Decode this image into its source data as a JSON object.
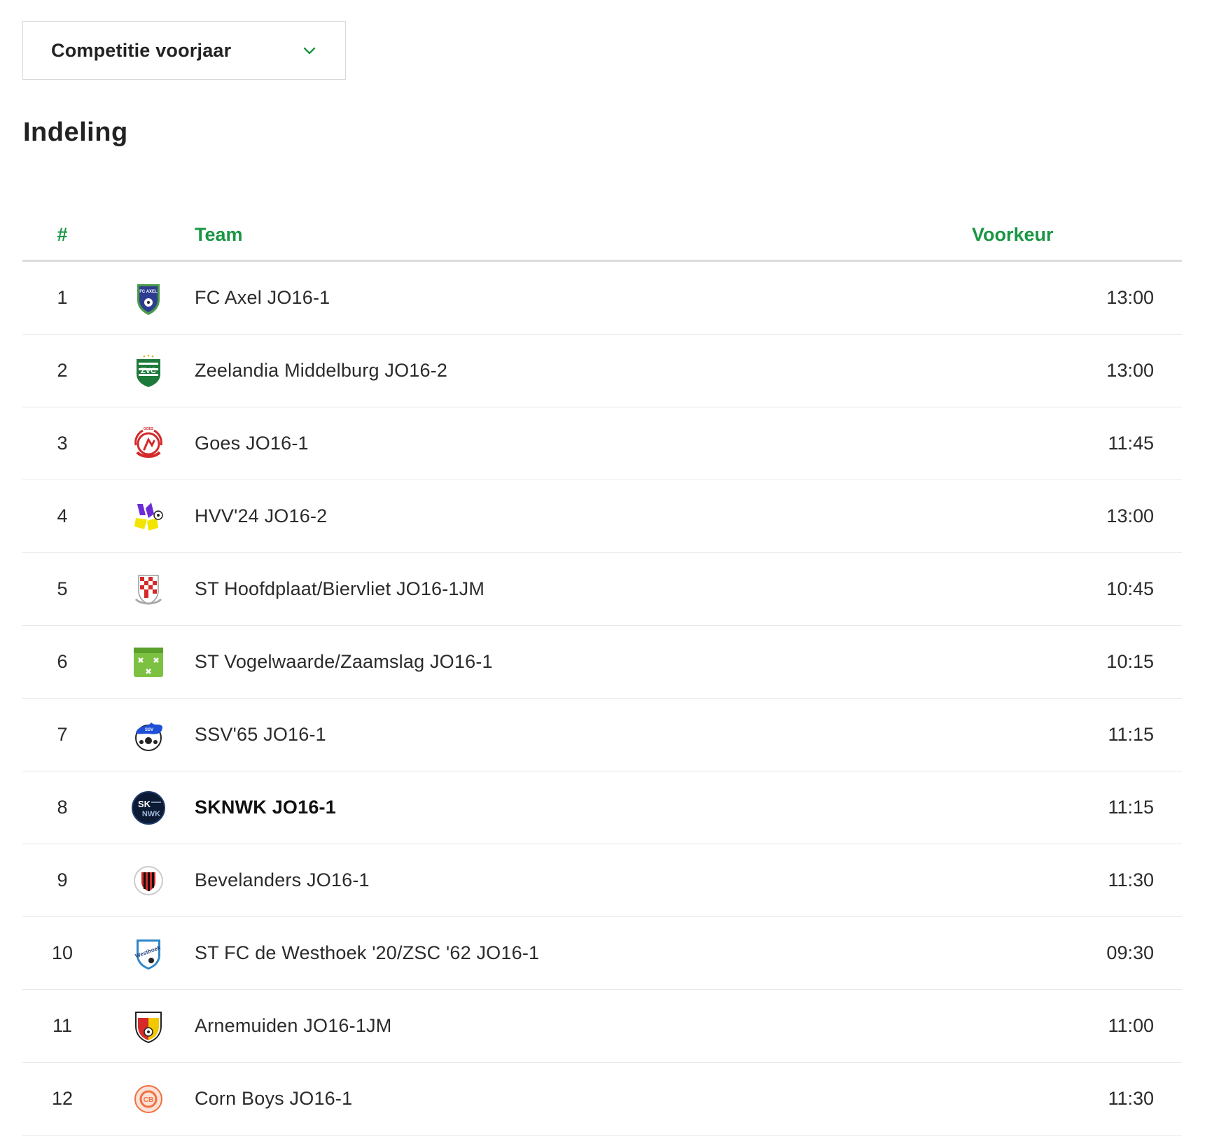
{
  "competition_select": {
    "value": "Competitie voorjaar",
    "icon": "chevron-down-icon",
    "accent_color": "#1a9644"
  },
  "page_title": "Indeling",
  "table": {
    "headers": {
      "rank": "#",
      "team": "Team",
      "preference": "Voorkeur"
    },
    "header_color": "#1a9644",
    "rows": [
      {
        "rank": "1",
        "team": "FC Axel JO16-1",
        "preference": "13:00",
        "logo": "fc-axel-logo",
        "highlight": false
      },
      {
        "rank": "2",
        "team": "Zeelandia Middelburg JO16-2",
        "preference": "13:00",
        "logo": "zeelandia-middelburg-logo",
        "highlight": false
      },
      {
        "rank": "3",
        "team": "Goes JO16-1",
        "preference": "11:45",
        "logo": "goes-logo",
        "highlight": false
      },
      {
        "rank": "4",
        "team": "HVV'24 JO16-2",
        "preference": "13:00",
        "logo": "hvv24-logo",
        "highlight": false
      },
      {
        "rank": "5",
        "team": "ST Hoofdplaat/Biervliet JO16-1JM",
        "preference": "10:45",
        "logo": "hoofdplaat-biervliet-logo",
        "highlight": false
      },
      {
        "rank": "6",
        "team": "ST Vogelwaarde/Zaamslag JO16-1",
        "preference": "10:15",
        "logo": "vogelwaarde-zaamslag-logo",
        "highlight": false
      },
      {
        "rank": "7",
        "team": "SSV'65 JO16-1",
        "preference": "11:15",
        "logo": "ssv65-logo",
        "highlight": false
      },
      {
        "rank": "8",
        "team": "SKNWK JO16-1",
        "preference": "11:15",
        "logo": "sknwk-logo",
        "highlight": true
      },
      {
        "rank": "9",
        "team": "Bevelanders JO16-1",
        "preference": "11:30",
        "logo": "bevelanders-logo",
        "highlight": false
      },
      {
        "rank": "10",
        "team": "ST FC de Westhoek '20/ZSC '62 JO16-1",
        "preference": "09:30",
        "logo": "westhoek-logo",
        "highlight": false
      },
      {
        "rank": "11",
        "team": "Arnemuiden JO16-1JM",
        "preference": "11:00",
        "logo": "arnemuiden-logo",
        "highlight": false
      },
      {
        "rank": "12",
        "team": "Corn Boys JO16-1",
        "preference": "11:30",
        "logo": "corn-boys-logo",
        "highlight": false
      }
    ]
  }
}
